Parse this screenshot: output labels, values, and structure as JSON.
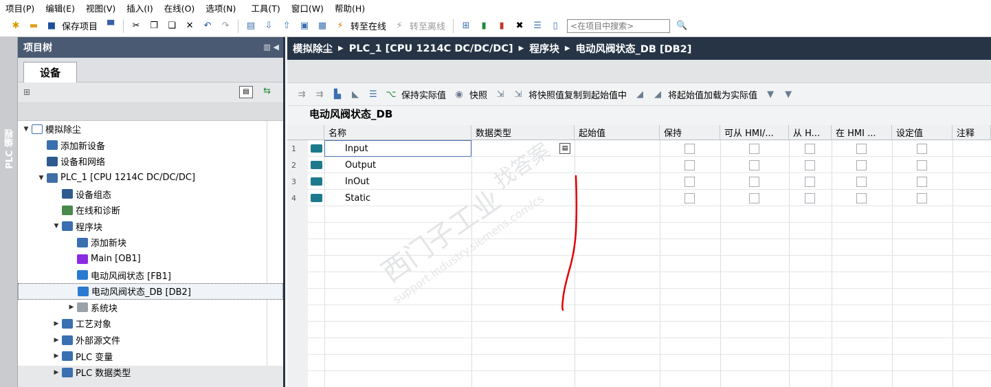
{
  "menu": [
    "项目(P)",
    "编辑(E)",
    "视图(V)",
    "插入(I)",
    "在线(O)",
    "选项(N)",
    "工具(T)",
    "窗口(W)",
    "帮助(H)"
  ],
  "toolbar": {
    "save_project": "保存项目",
    "go_online": "转至在线",
    "go_offline": "转至离线",
    "search_placeholder": "<在项目中搜索>"
  },
  "vertical_label": "PLC 编程",
  "tree": {
    "title": "项目树",
    "tab": "设备",
    "items": [
      {
        "label": "模拟除尘",
        "level": 0,
        "arrow": "▼",
        "icon": "project"
      },
      {
        "label": "添加新设备",
        "level": 1,
        "arrow": "",
        "icon": "add"
      },
      {
        "label": "设备和网络",
        "level": 1,
        "arrow": "",
        "icon": "network"
      },
      {
        "label": "PLC_1 [CPU 1214C DC/DC/DC]",
        "level": 1,
        "arrow": "▼",
        "icon": "plc"
      },
      {
        "label": "设备组态",
        "level": 2,
        "arrow": "",
        "icon": "config"
      },
      {
        "label": "在线和诊断",
        "level": 2,
        "arrow": "",
        "icon": "diag"
      },
      {
        "label": "程序块",
        "level": 2,
        "arrow": "▼",
        "icon": "folder"
      },
      {
        "label": "添加新块",
        "level": 3,
        "arrow": "",
        "icon": "add"
      },
      {
        "label": "Main [OB1]",
        "level": 3,
        "arrow": "",
        "icon": "ob"
      },
      {
        "label": "电动风阀状态 [FB1]",
        "level": 3,
        "arrow": "",
        "icon": "fb"
      },
      {
        "label": "电动风阀状态_DB [DB2]",
        "level": 3,
        "arrow": "",
        "icon": "db",
        "selected": true
      },
      {
        "label": "系统块",
        "level": 3,
        "arrow": "▶",
        "icon": "folder-gray"
      },
      {
        "label": "工艺对象",
        "level": 2,
        "arrow": "▶",
        "icon": "folder"
      },
      {
        "label": "外部源文件",
        "level": 2,
        "arrow": "▶",
        "icon": "folder"
      },
      {
        "label": "PLC 变量",
        "level": 2,
        "arrow": "▶",
        "icon": "folder"
      },
      {
        "label": "PLC 数据类型",
        "level": 2,
        "arrow": "▶",
        "icon": "folder"
      }
    ]
  },
  "breadcrumb": [
    "模拟除尘",
    "PLC_1 [CPU 1214C DC/DC/DC]",
    "程序块",
    "电动风阀状态_DB [DB2]"
  ],
  "editor_toolbar": {
    "keep_actual": "保持实际值",
    "snapshot": "快照",
    "copy_snapshot": "将快照值复制到起始值中",
    "load_start": "将起始值加载为实际值"
  },
  "db_title": "电动风阀状态_DB",
  "columns": [
    "名称",
    "数据类型",
    "起始值",
    "保持",
    "可从 HMI/...",
    "从 H...",
    "在 HMI ...",
    "设定值",
    "注释"
  ],
  "rows": [
    {
      "num": "1",
      "name": "Input"
    },
    {
      "num": "2",
      "name": "Output"
    },
    {
      "num": "3",
      "name": "InOut"
    },
    {
      "num": "4",
      "name": "Static"
    }
  ],
  "watermark": {
    "line1": "西门子工业",
    "line2": "support.industry.siemens.com/cs",
    "line3": "找答案"
  },
  "colors": {
    "header_dark": "#263446",
    "tree_header": "#4a5a72",
    "annotation": "#e00000"
  }
}
